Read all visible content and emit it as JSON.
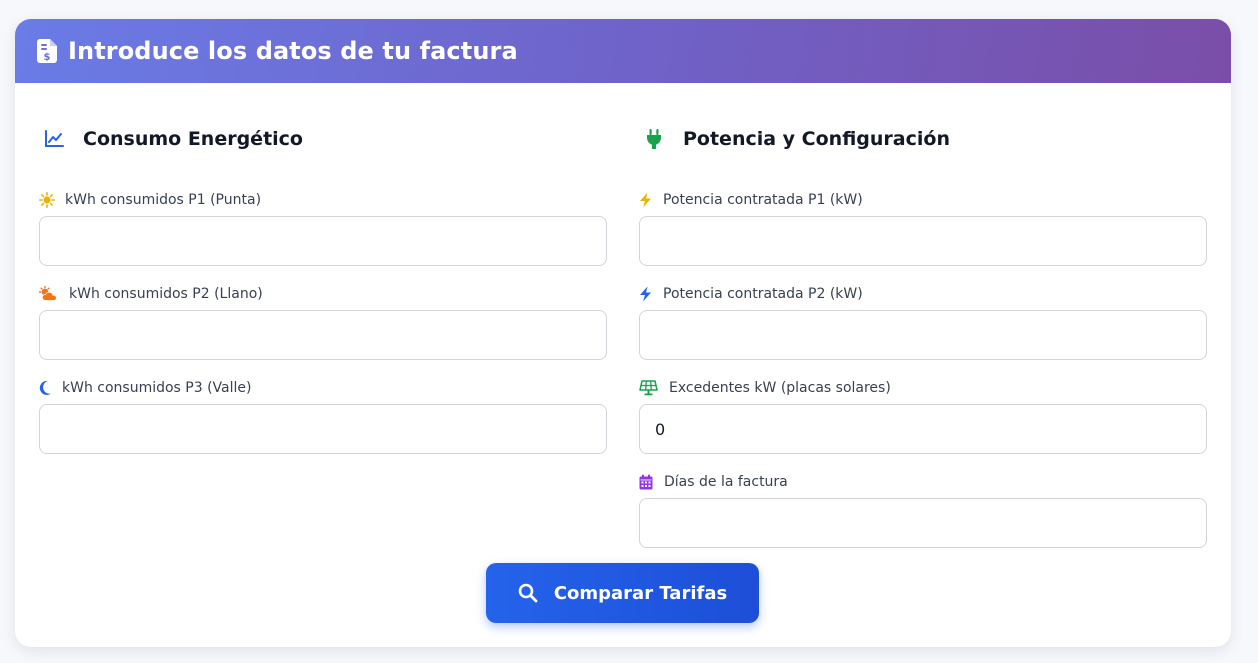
{
  "header": {
    "title": "Introduce los datos de tu factura",
    "icon": "invoice-dollar-icon"
  },
  "left_section": {
    "title": "Consumo Energético",
    "icon": "chart-line-icon",
    "fields": [
      {
        "label": "kWh consumidos P1 (Punta)",
        "value": "",
        "icon": "sun-icon",
        "icon_color": "#eab308"
      },
      {
        "label": "kWh consumidos P2 (Llano)",
        "value": "",
        "icon": "cloud-sun-icon",
        "icon_color": "#f97316"
      },
      {
        "label": "kWh consumidos P3 (Valle)",
        "value": "",
        "icon": "moon-icon",
        "icon_color": "#2563eb"
      }
    ]
  },
  "right_section": {
    "title": "Potencia y Configuración",
    "icon": "plug-icon",
    "fields": [
      {
        "label": "Potencia contratada P1 (kW)",
        "value": "",
        "icon": "bolt-icon",
        "icon_color": "#eab308"
      },
      {
        "label": "Potencia contratada P2 (kW)",
        "value": "",
        "icon": "bolt-icon",
        "icon_color": "#2563eb"
      },
      {
        "label": "Excedentes kW (placas solares)",
        "value": "0",
        "icon": "solar-panel-icon",
        "icon_color": "#16a34a"
      },
      {
        "label": "Días de la factura",
        "value": "",
        "icon": "calendar-icon",
        "icon_color": "#9333ea"
      }
    ]
  },
  "button": {
    "label": "Comparar Tarifas",
    "icon": "search-icon"
  },
  "colors": {
    "header_gradient_start": "#6a7ce6",
    "header_gradient_end": "#7a4ea8",
    "button": "#2563eb",
    "plug_icon": "#16a34a",
    "chart_icon": "#2563eb"
  }
}
